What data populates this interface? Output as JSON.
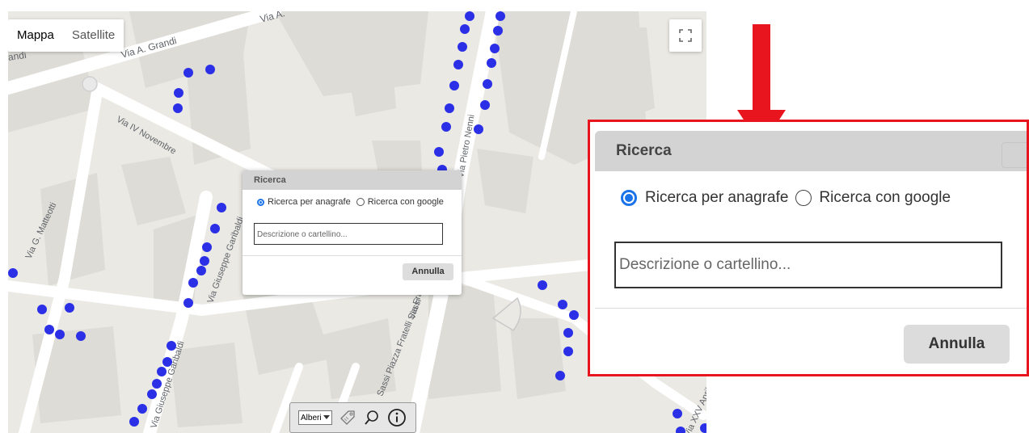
{
  "map": {
    "tabs": [
      {
        "label": "Mappa",
        "active": true
      },
      {
        "label": "Satellite",
        "active": false
      }
    ],
    "fullscreen_icon": "fullscreen-icon",
    "streets": [
      "Via A. Grandi",
      "andi",
      "Via A.",
      "Via IV Novembre",
      "Via G. Matteotti",
      "Via Giuseppe Garibaldi",
      "Via Giuseppe Garibaldi",
      "Via Pietro Nenni",
      "Via Fratelli Sassi",
      "Sassi Piazza Fratelli Sassi",
      "Via XXV Aprile"
    ],
    "dot_color": "#2b2fe6"
  },
  "dialog": {
    "title": "Ricerca",
    "radio_anagrafe": "Ricerca per anagrafe",
    "radio_google": "Ricerca con google",
    "placeholder": "Descrizione o cartellino...",
    "cancel": "Annulla"
  },
  "toolbar": {
    "layer_select": "Alberi",
    "icons": [
      "tag-icon",
      "search-icon",
      "info-icon"
    ]
  },
  "annotation": {
    "arrow_color": "#e8141e",
    "highlight_color": "#e8141e"
  }
}
